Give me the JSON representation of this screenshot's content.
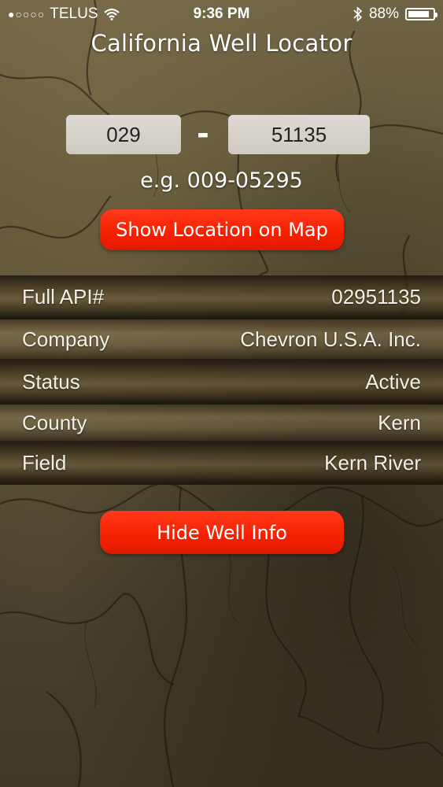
{
  "status_bar": {
    "signal_dots": "●○○○○",
    "carrier": "TELUS",
    "wifi_icon": "wifi-icon",
    "time": "9:36 PM",
    "bluetooth_icon": "bluetooth-icon",
    "battery_percent": "88%",
    "battery_level": 0.88
  },
  "app": {
    "title": "California Well Locator"
  },
  "search": {
    "api_part1": "029",
    "separator": "-",
    "api_part2": "51135",
    "example": "e.g. 009-05295",
    "show_map_label": "Show Location on Map"
  },
  "well_info": {
    "rows": [
      {
        "label": "Full API#",
        "value": "02951135"
      },
      {
        "label": "Company",
        "value": "Chevron U.S.A. Inc."
      },
      {
        "label": "Status",
        "value": "Active"
      },
      {
        "label": "County",
        "value": "Kern"
      },
      {
        "label": "Field",
        "value": "Kern River"
      }
    ],
    "hide_label": "Hide Well Info"
  },
  "colors": {
    "button_red": "#f51f00",
    "input_bg": "#d6d2cb"
  }
}
